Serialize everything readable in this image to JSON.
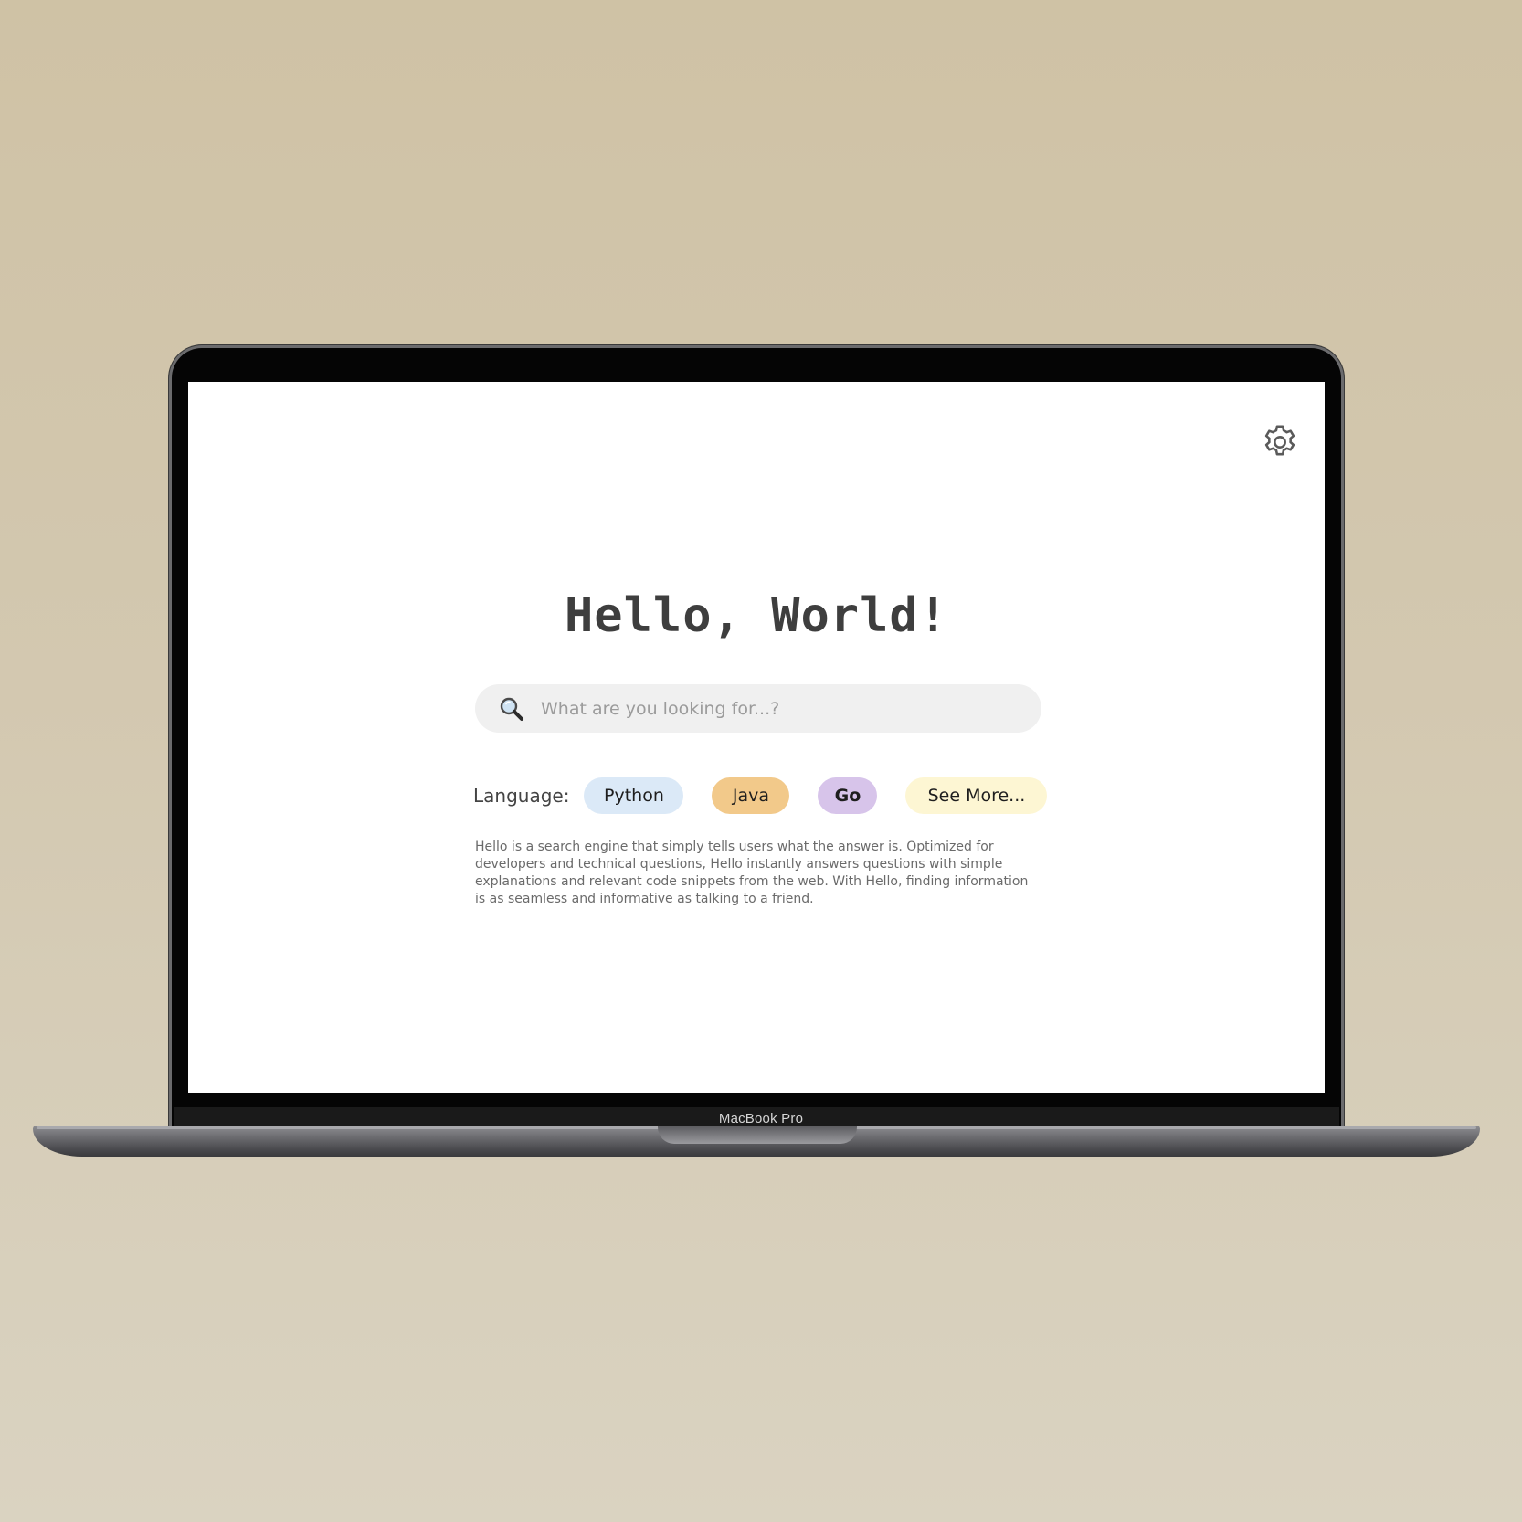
{
  "device": {
    "label": "MacBook Pro"
  },
  "page": {
    "title": "Hello, World!",
    "settings_icon": "gear-icon"
  },
  "search": {
    "icon": "search-icon",
    "placeholder": "What are you looking for...?",
    "value": ""
  },
  "language": {
    "label": "Language:",
    "options": [
      {
        "label": "Python",
        "color": "#dbe9f7"
      },
      {
        "label": "Java",
        "color": "#f2c98a"
      },
      {
        "label": "Go",
        "color": "#d7c4ea"
      },
      {
        "label": "See More...",
        "color": "#fdf6d3"
      }
    ]
  },
  "description": "Hello is a search engine that simply tells users what the answer is. Optimized for developers and technical questions, Hello instantly answers questions with simple explanations and relevant code snippets from the web. With Hello, finding information is as seamless and informative as talking to a friend."
}
